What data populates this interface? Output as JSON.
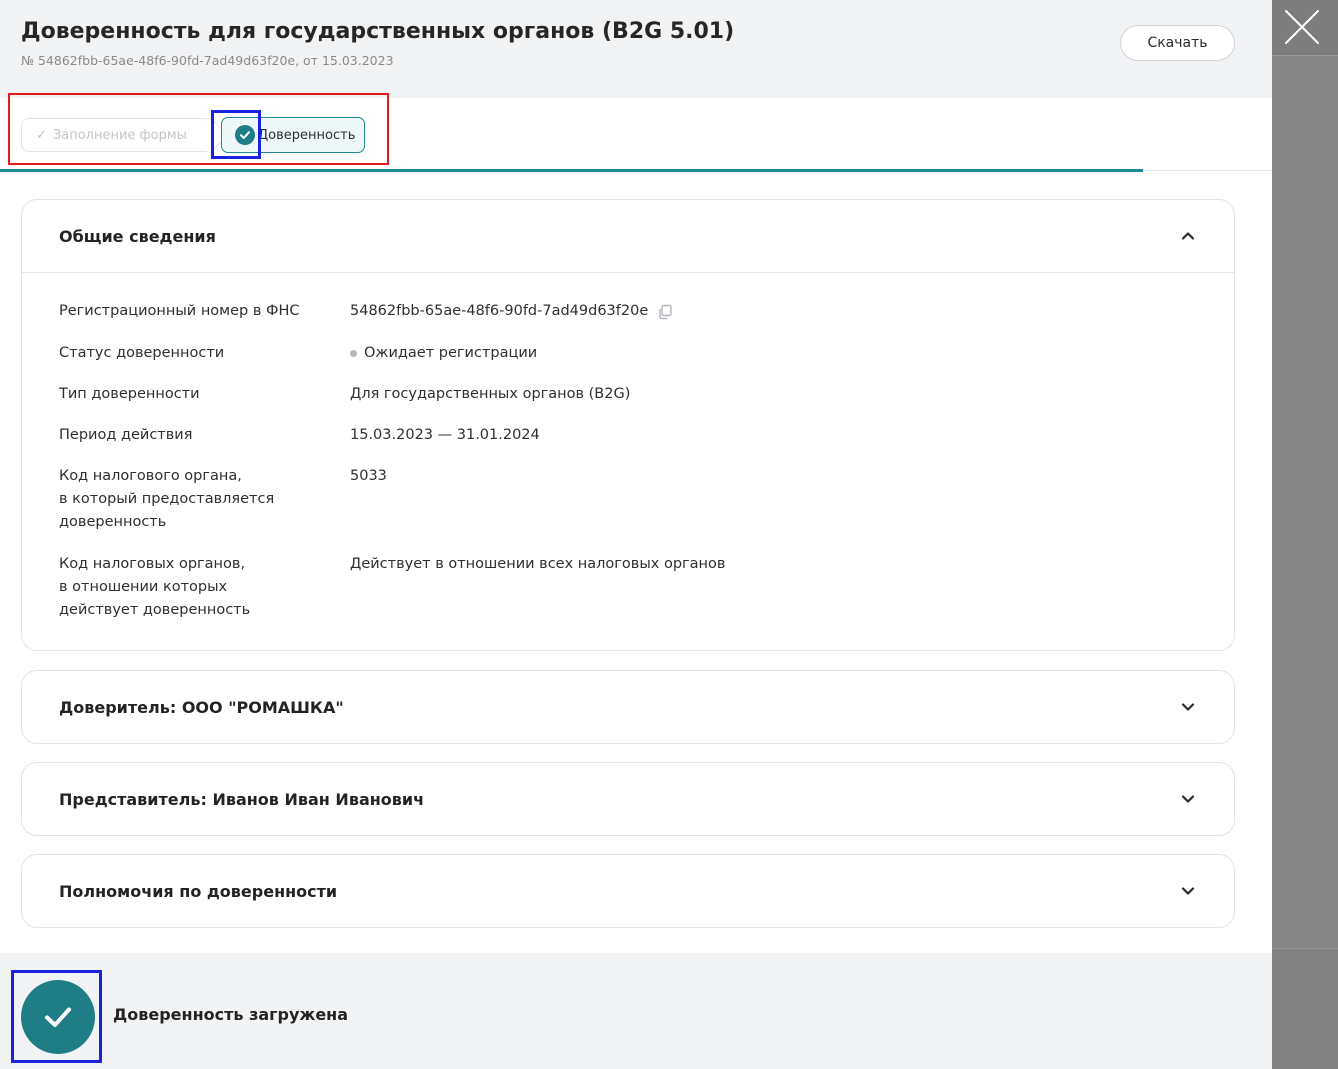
{
  "header": {
    "title": "Доверенность для государственных органов (B2G 5.01)",
    "subtitle": "№ 54862fbb-65ae-48f6-90fd-7ad49d63f20e, от 15.03.2023",
    "download_label": "Скачать"
  },
  "steps": [
    {
      "label": "Заполнение формы",
      "state": "completed"
    },
    {
      "label": "Доверенность",
      "state": "active"
    }
  ],
  "general": {
    "title": "Общие сведения",
    "rows": [
      {
        "label": "Регистрационный номер в ФНС",
        "value": "54862fbb-65ae-48f6-90fd-7ad49d63f20e"
      },
      {
        "label": "Статус доверенности",
        "value": "Ожидает регистрации"
      },
      {
        "label": "Тип доверенности",
        "value": "Для государственных органов (B2G)"
      },
      {
        "label": "Период действия",
        "value": "15.03.2023 — 31.01.2024"
      },
      {
        "label": "Код налогового органа,\nв который предоставляется\nдоверенность",
        "value": "5033"
      },
      {
        "label": "Код налоговых органов,\nв отношении которых\nдействует доверенность",
        "value": "Действует в отношении всех налоговых органов"
      }
    ]
  },
  "sections": [
    {
      "title": "Доверитель: ООО \"РОМАШКА\""
    },
    {
      "title": "Представитель: Иванов Иван Иванович"
    },
    {
      "title": "Полномочия по доверенности"
    }
  ],
  "footer": {
    "message": "Доверенность загружена"
  },
  "colors": {
    "accent": "#1e7d86",
    "highlight_red": "#e11b1b",
    "highlight_blue": "#1a22e0"
  }
}
